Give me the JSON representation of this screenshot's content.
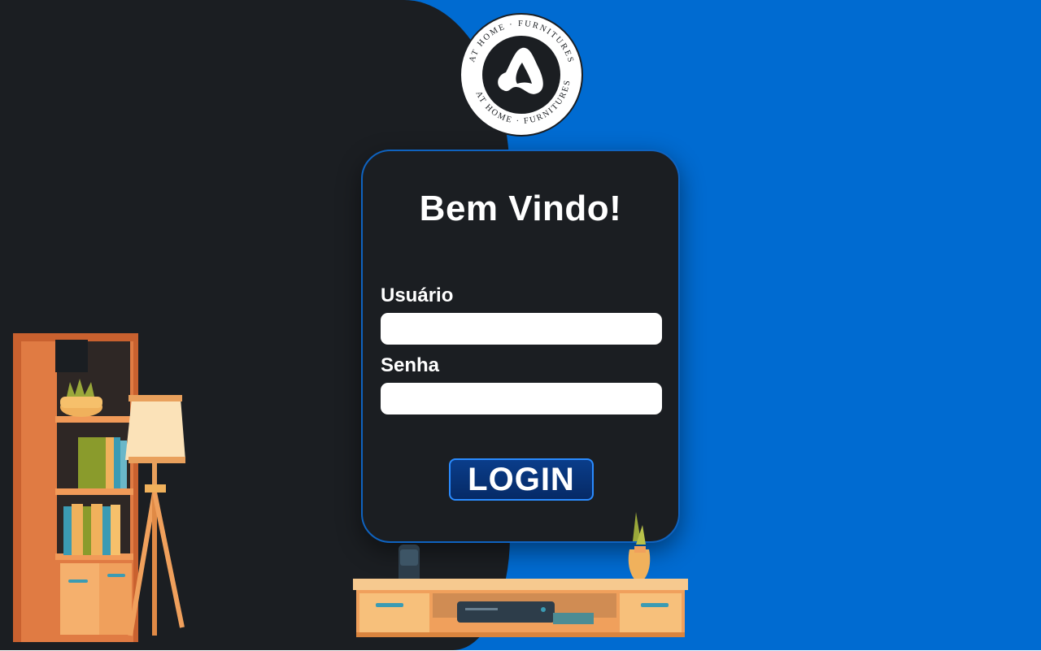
{
  "logo": {
    "text_top": "AT HOME · FURNITURES",
    "text_bottom": "AT HOME · FURNITURES",
    "icon": "furniture-a-logo"
  },
  "login_card": {
    "title": "Bem Vindo!",
    "username_label": "Usuário",
    "username_value": "",
    "password_label": "Senha",
    "password_value": "",
    "login_button": "LOGIN"
  },
  "colors": {
    "dark_bg": "#1b1e22",
    "blue_bg": "#006bd1",
    "accent_blue": "#2a8bff",
    "wood": "#d9743e"
  },
  "decor": {
    "left": [
      "bookshelf-icon",
      "floor-lamp-icon"
    ],
    "bottom": [
      "tv-stand-icon",
      "smart-speaker-icon",
      "set-top-box-icon",
      "plant-vase-icon"
    ]
  }
}
